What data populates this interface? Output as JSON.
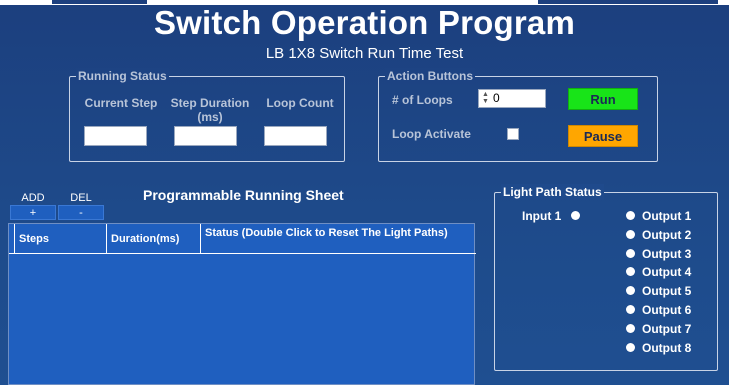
{
  "header": {
    "title": "Switch Operation Program",
    "subtitle": "LB 1X8 Switch Run Time Test"
  },
  "running_status": {
    "legend": "Running Status",
    "current_step_label": "Current Step",
    "step_duration_label": "Step Duration (ms)",
    "loop_count_label": "Loop Count",
    "current_step_value": "",
    "step_duration_value": "",
    "loop_count_value": ""
  },
  "action_buttons": {
    "legend": "Action Buttons",
    "loops_label": "# of Loops",
    "loops_value": "0",
    "run_label": "Run",
    "loop_activate_label": "Loop Activate",
    "loop_activate_checked": false,
    "pause_label": "Pause",
    "run_color": "#18e418",
    "pause_color": "#ffa600"
  },
  "sheet": {
    "add_label": "ADD",
    "add_button": "+",
    "del_label": "DEL",
    "del_button": "-",
    "title": "Programmable Running Sheet",
    "columns": [
      "Steps",
      "Duration(ms)",
      "Status (Double Click to Reset The Light Paths)"
    ],
    "rows": []
  },
  "light_path": {
    "legend": "Light Path Status",
    "input_label": "Input 1",
    "outputs": [
      "Output 1",
      "Output 2",
      "Output 3",
      "Output 4",
      "Output 5",
      "Output 6",
      "Output 7",
      "Output 8"
    ]
  },
  "icons": {
    "spin": "up-down-spinner-icon",
    "indicator": "circle-indicator-icon"
  }
}
